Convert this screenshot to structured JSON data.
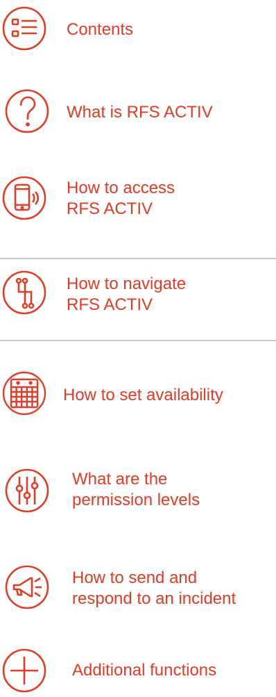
{
  "colors": {
    "accent": "#e23b26",
    "divider": "#c9c9c9",
    "background": "#ffffff"
  },
  "menu": {
    "items": [
      {
        "icon": "list-icon",
        "lines": [
          "Contents"
        ]
      },
      {
        "icon": "question-icon",
        "lines": [
          "What is RFS ACTIV"
        ]
      },
      {
        "icon": "phone-icon",
        "lines": [
          "How to access",
          "RFS ACTIV"
        ]
      },
      {
        "icon": "navigate-icon",
        "lines": [
          "How to navigate",
          "RFS ACTIV"
        ]
      },
      {
        "icon": "calendar-icon",
        "lines": [
          "How to set availability"
        ]
      },
      {
        "icon": "sliders-icon",
        "lines": [
          "What are the",
          "permission levels"
        ]
      },
      {
        "icon": "megaphone-icon",
        "lines": [
          "How to send and",
          "respond to an incident"
        ]
      },
      {
        "icon": "plus-icon",
        "lines": [
          "Additional functions"
        ]
      }
    ]
  }
}
